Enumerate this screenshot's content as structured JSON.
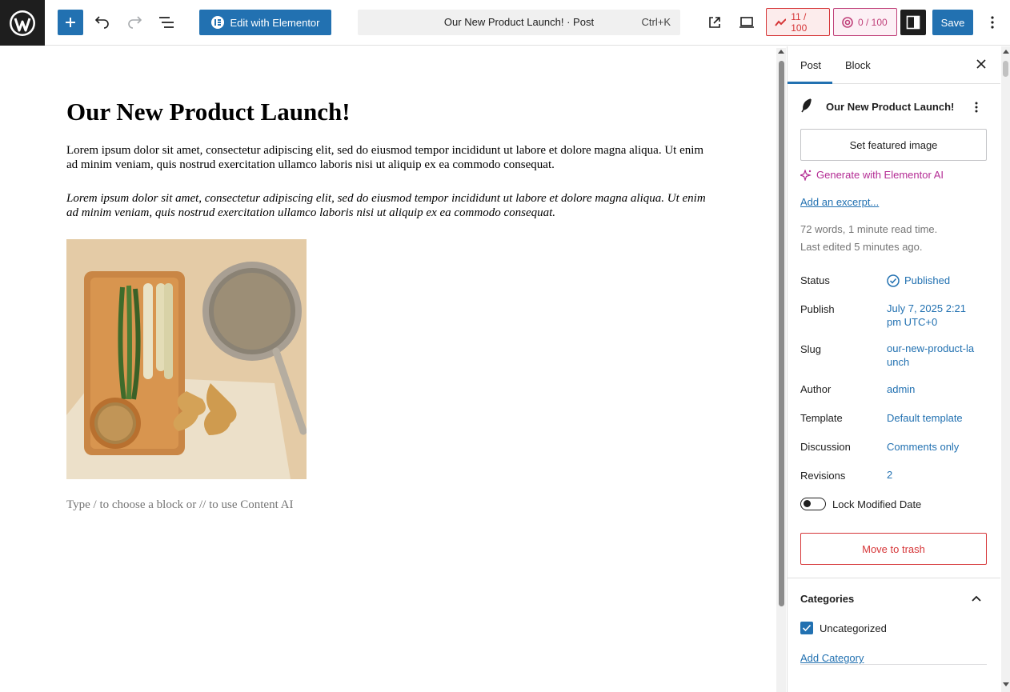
{
  "toolbar": {
    "elementor_label": "Edit with Elementor",
    "command_title": "Our New Product Launch! · Post",
    "command_shortcut": "Ctrl+K",
    "seo_score": "11 / 100",
    "readability_score": "0 / 100",
    "save_label": "Save"
  },
  "post": {
    "title": "Our New Product Launch!",
    "paragraph1": "Lorem ipsum dolor sit amet, consectetur adipiscing elit, sed do eiusmod tempor incididunt ut labore et dolore magna aliqua. Ut enim ad minim veniam, quis nostrud exercitation ullamco laboris nisi ut aliquip ex ea commodo consequat.",
    "paragraph2": "Lorem ipsum dolor sit amet, consectetur adipiscing elit, sed do eiusmod tempor incididunt ut labore et dolore magna aliqua. Ut enim ad minim veniam, quis nostrud exercitation ullamco laboris nisi ut aliquip ex ea commodo consequat.",
    "placeholder": "Type / to choose a block or // to use Content AI"
  },
  "sidebar": {
    "tabs": [
      "Post",
      "Block"
    ],
    "post_title": "Our New Product Launch!",
    "featured_image_label": "Set featured image",
    "generate_ai_label": "Generate with Elementor AI",
    "excerpt_label": "Add an excerpt...",
    "word_count": "72 words, 1 minute read time.",
    "last_edited": "Last edited 5 minutes ago.",
    "rows": {
      "status": {
        "label": "Status",
        "value": "Published"
      },
      "publish": {
        "label": "Publish",
        "value": "July 7, 2025 2:21 pm UTC+0"
      },
      "slug": {
        "label": "Slug",
        "value": "our-new-product-launch"
      },
      "author": {
        "label": "Author",
        "value": "admin"
      },
      "template": {
        "label": "Template",
        "value": "Default template"
      },
      "discussion": {
        "label": "Discussion",
        "value": "Comments only"
      },
      "revisions": {
        "label": "Revisions",
        "value": "2"
      }
    },
    "lock_modified_label": "Lock Modified Date",
    "trash_label": "Move to trash",
    "categories_title": "Categories",
    "category_item": "Uncategorized",
    "add_category_label": "Add Category"
  },
  "colors": {
    "accent": "#2271b1",
    "danger": "#d63638",
    "ai": "#b42c94"
  }
}
